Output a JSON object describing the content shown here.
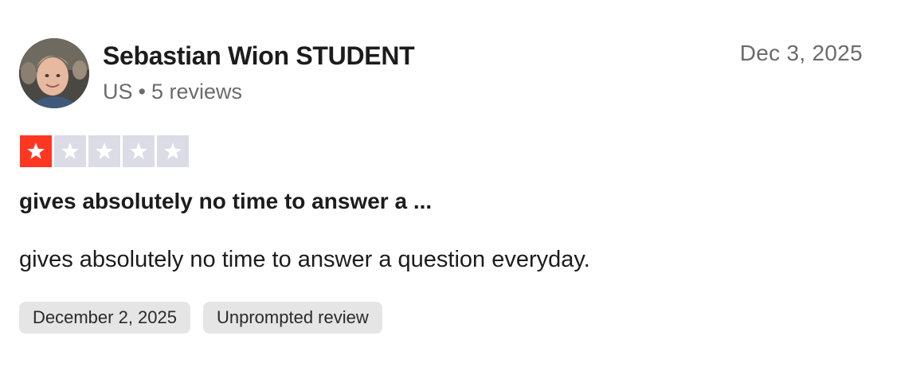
{
  "reviewer": {
    "name": "Sebastian Wion STUDENT",
    "country": "US",
    "separator": "•",
    "reviews_count": "5 reviews"
  },
  "review": {
    "date": "Dec 3, 2025",
    "rating": 1,
    "rating_max": 5,
    "title": "gives absolutely no time to answer a ...",
    "body": "gives absolutely no time to answer a question everyday.",
    "tags": {
      "experience_date": "December 2, 2025",
      "review_type": "Unprompted review"
    }
  },
  "colors": {
    "star_filled": "#ff3722",
    "star_empty": "#dcdce6",
    "tag_background": "#e5e5e5",
    "muted_text": "#6b6b6b"
  },
  "icons": {
    "avatar": "avatar-photo",
    "star": "star-icon"
  }
}
